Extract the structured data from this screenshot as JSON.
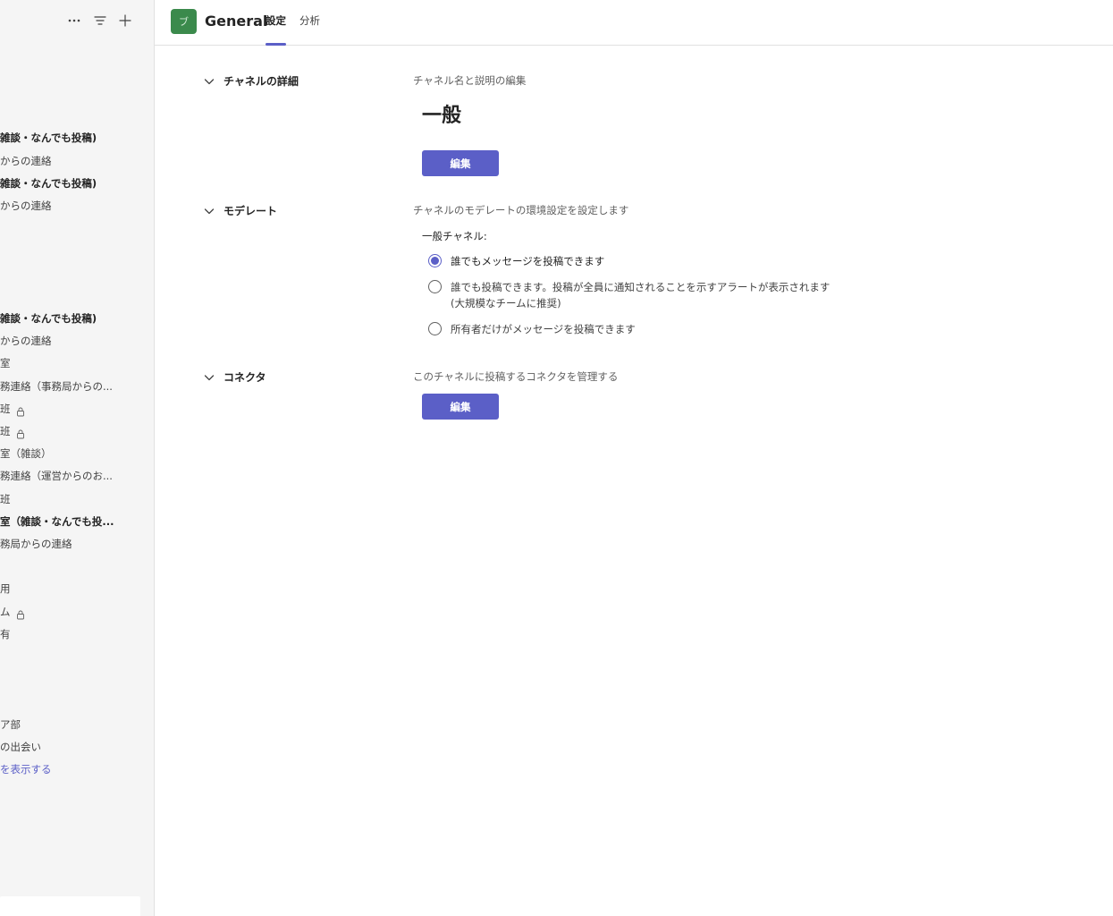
{
  "sidebar": {
    "icons": [
      "more-icon",
      "filter-icon",
      "add-icon"
    ],
    "items": [
      {
        "label": "雑談・なんでも投稿)",
        "bold": true,
        "lock": false
      },
      {
        "label": "からの連絡",
        "bold": false,
        "lock": false
      },
      {
        "label": "雑談・なんでも投稿)",
        "bold": true,
        "lock": false
      },
      {
        "label": "からの連絡",
        "bold": false,
        "lock": false
      },
      {
        "label": "雑談・なんでも投稿)",
        "bold": true,
        "lock": false
      },
      {
        "label": "からの連絡",
        "bold": false,
        "lock": false
      },
      {
        "label": "室",
        "bold": false,
        "lock": false
      },
      {
        "label": "務連絡（事務局からの...",
        "bold": false,
        "lock": false
      },
      {
        "label": "班",
        "bold": false,
        "lock": true
      },
      {
        "label": "班",
        "bold": false,
        "lock": true
      },
      {
        "label": "室（雑談）",
        "bold": false,
        "lock": false
      },
      {
        "label": "務連絡（運営からのお...",
        "bold": false,
        "lock": false
      },
      {
        "label": "班",
        "bold": false,
        "lock": false
      },
      {
        "label": "室（雑談・なんでも投...",
        "bold": true,
        "lock": false
      },
      {
        "label": "務局からの連絡",
        "bold": false,
        "lock": false
      },
      {
        "label": "用",
        "bold": false,
        "lock": false
      },
      {
        "label": "ム",
        "bold": false,
        "lock": true
      },
      {
        "label": "有",
        "bold": false,
        "lock": false
      },
      {
        "label": "ア部",
        "bold": false,
        "lock": false
      },
      {
        "label": "の出会い",
        "bold": false,
        "lock": false
      },
      {
        "label": "を表示する",
        "bold": false,
        "lock": false,
        "link": true
      }
    ]
  },
  "header": {
    "avatar_text": "ブ",
    "title": "General",
    "tabs": [
      {
        "label": "設定",
        "active": true
      },
      {
        "label": "分析",
        "active": false
      }
    ],
    "accent": "#5b5fc7"
  },
  "main": {
    "details": {
      "toggle": "チャネルの詳細",
      "description": "チャネル名と説明の編集",
      "channel_name": "一般",
      "edit_label": "編集"
    },
    "moderation": {
      "toggle": "モデレート",
      "description": "チャネルのモデレートの環境設定を設定します",
      "sub_label": "一般チャネル:",
      "options": [
        {
          "label": "誰でもメッセージを投稿できます",
          "checked": true
        },
        {
          "label": "誰でも投稿できます。投稿が全員に通知されることを示すアラートが表示されます",
          "label2": "(大規模なチームに推奨)",
          "checked": false
        },
        {
          "label": "所有者だけがメッセージを投稿できます",
          "checked": false
        }
      ]
    },
    "connectors": {
      "toggle": "コネクタ",
      "description": "このチャネルに投稿するコネクタを管理する",
      "edit_label": "編集"
    }
  }
}
